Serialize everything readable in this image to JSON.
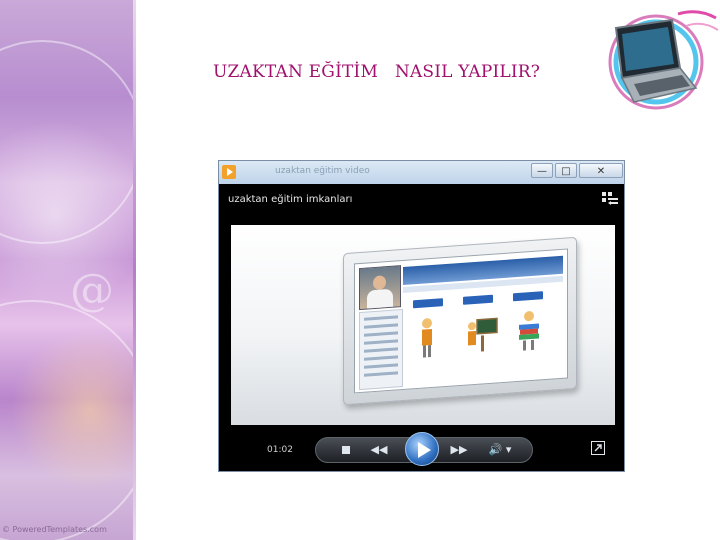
{
  "slide": {
    "title": "UZAKTAN EĞİTİM   NASIL YAPILIR?",
    "watermark": "© PoweredTemplates.com"
  },
  "player": {
    "window_title": "uzaktan eğitim video",
    "caption": "uzaktan eğitim imkanları",
    "time": "01:02",
    "buttons": {
      "minimize": "—",
      "maximize": "□",
      "close": "✕",
      "stop": "stop",
      "previous": "◀◀",
      "play": "play",
      "next": "▶▶",
      "volume": "🔊 ▾"
    }
  },
  "colors": {
    "title": "#a0106c",
    "player_bg": "#000000",
    "accent": "#2f6fc0"
  },
  "icons": [
    "app-icon",
    "layout-switch-icon",
    "stop-icon",
    "previous-icon",
    "play-icon",
    "next-icon",
    "volume-icon",
    "fullscreen-icon",
    "laptop-illustration"
  ]
}
